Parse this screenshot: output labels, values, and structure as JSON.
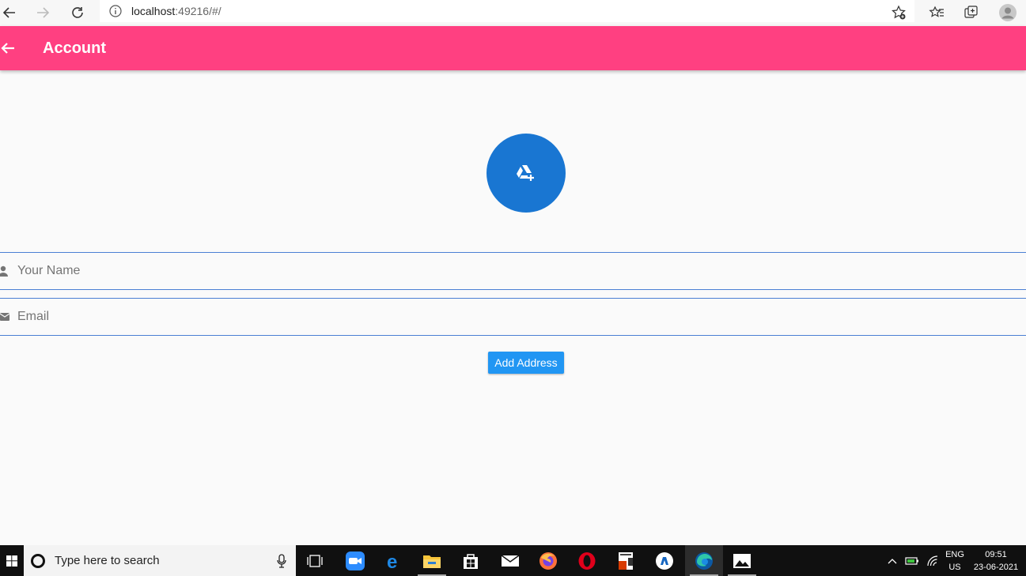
{
  "browser": {
    "url_host": "localhost",
    "url_rest": ":49216/#/"
  },
  "app_bar": {
    "title": "Account",
    "color": "#ff4081"
  },
  "avatar": {
    "icon": "add-to-drive-icon",
    "color": "#1976d2"
  },
  "form": {
    "name_placeholder": "Your Name",
    "email_placeholder": "Email",
    "add_address_label": "Add Address",
    "button_color": "#2196f3"
  },
  "taskbar": {
    "search_placeholder": "Type here to search",
    "apps": [
      "task-view-icon",
      "zoom-icon",
      "edge-legacy-icon",
      "file-explorer-icon",
      "store-icon",
      "mail-icon",
      "firefox-icon",
      "opera-icon",
      "ms-project-icon",
      "app-icon",
      "edge-icon",
      "photos-icon"
    ],
    "lang_top": "ENG",
    "lang_bottom": "US",
    "time": "09:51",
    "date": "23-06-2021"
  }
}
